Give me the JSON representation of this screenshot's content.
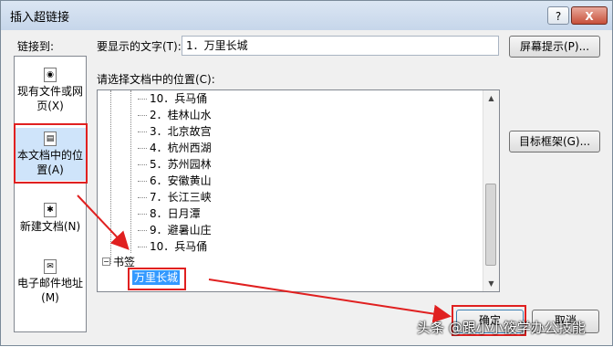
{
  "dialog": {
    "title": "插入超链接",
    "help_button": "?",
    "close_button": "X"
  },
  "link_to_label": "链接到:",
  "display_text_label": "要显示的文字(T):",
  "display_text_value": "1．万里长城",
  "screen_tip_button": "屏幕提示(P)...",
  "location_label": "请选择文档中的位置(C):",
  "sidebar": {
    "items": [
      {
        "label": "现有文件或网页(X)",
        "icon": "globe-file-icon"
      },
      {
        "label": "本文档中的位置(A)",
        "icon": "document-place-icon"
      },
      {
        "label": "新建文档(N)",
        "icon": "new-document-icon"
      },
      {
        "label": "电子邮件地址(M)",
        "icon": "email-icon"
      }
    ]
  },
  "tree": {
    "headings": [
      "10．兵马俑",
      "2．桂林山水",
      "3．北京故宫",
      "4．杭州西湖",
      "5．苏州园林",
      "6．安徽黄山",
      "7．长江三峡",
      "8．日月潭",
      "9．避暑山庄",
      "10．兵马俑"
    ],
    "bookmarks_label": "书签",
    "selected_bookmark": "万里长城"
  },
  "target_frame_button": "目标框架(G)...",
  "ok_button": "确定",
  "cancel_button": "取消",
  "watermark": "头条 @跟小小筱学办公技能",
  "annotation_color": "#e02020"
}
